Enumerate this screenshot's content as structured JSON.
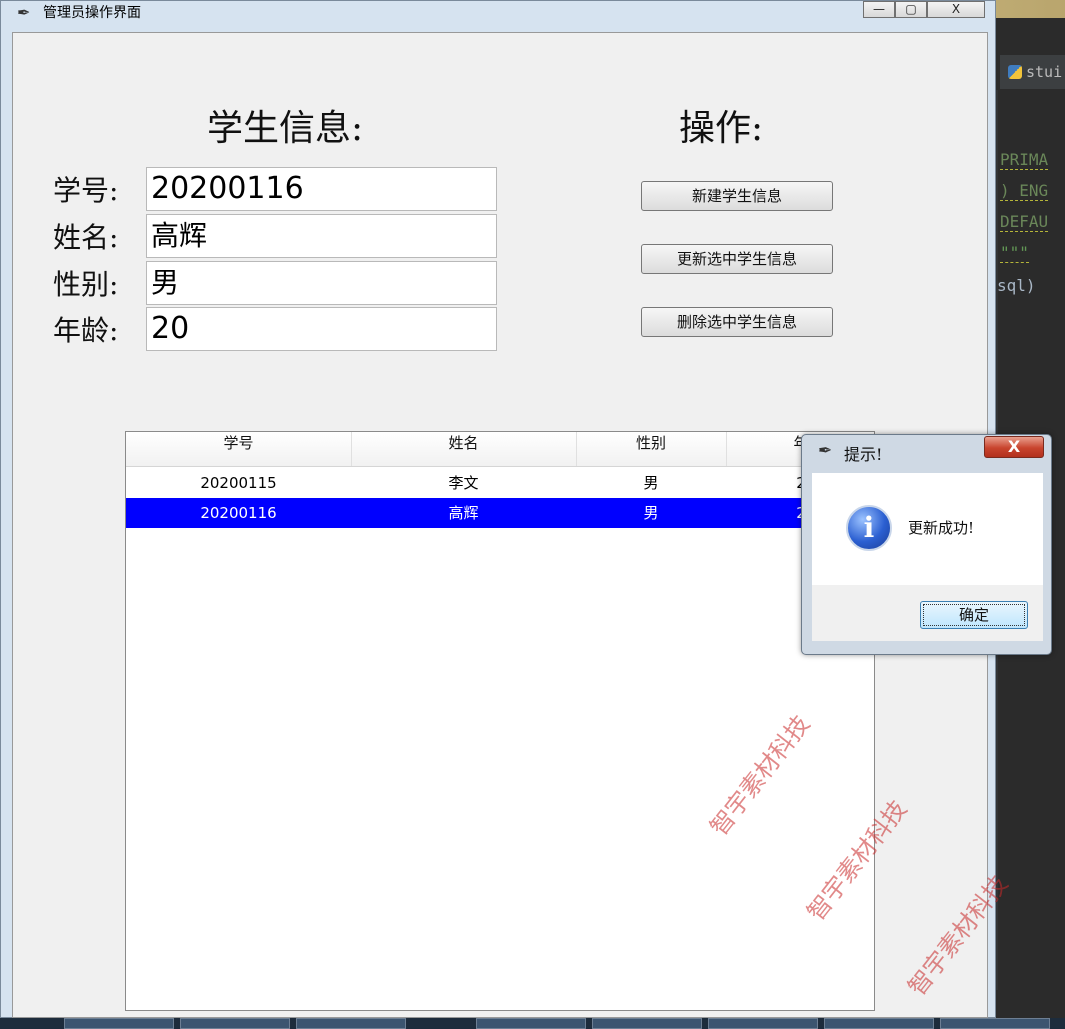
{
  "window": {
    "title": "管理员操作界面",
    "min": "—",
    "max": "▢",
    "close": "X"
  },
  "form": {
    "heading": "学生信息:",
    "id_label": "学号:",
    "id_value": "20200116",
    "name_label": "姓名:",
    "name_value": "高辉",
    "gender_label": "性别:",
    "gender_value": "男",
    "age_label": "年龄:",
    "age_value": "20"
  },
  "ops": {
    "heading": "操作:",
    "create_label": "新建学生信息",
    "update_label": "更新选中学生信息",
    "delete_label": "删除选中学生信息"
  },
  "table": {
    "columns": [
      "学号",
      "姓名",
      "性别",
      "年"
    ],
    "rows": [
      {
        "id": "20200115",
        "name": "李文",
        "gender": "男",
        "age": "2"
      },
      {
        "id": "20200116",
        "name": "高辉",
        "gender": "男",
        "age": "2"
      }
    ]
  },
  "dialog": {
    "title": "提示!",
    "close": "X",
    "message": "更新成功!",
    "ok_label": "确定"
  },
  "ide": {
    "tab_label": "stui",
    "lines": [
      "PRIMA",
      ") ENG",
      "DEFAU",
      "\"\"\"",
      "sql)"
    ]
  },
  "watermark": {
    "text": "智宇素材科技"
  },
  "colors": {
    "selection": "#0000ff",
    "dialog_close": "#c8442e"
  }
}
